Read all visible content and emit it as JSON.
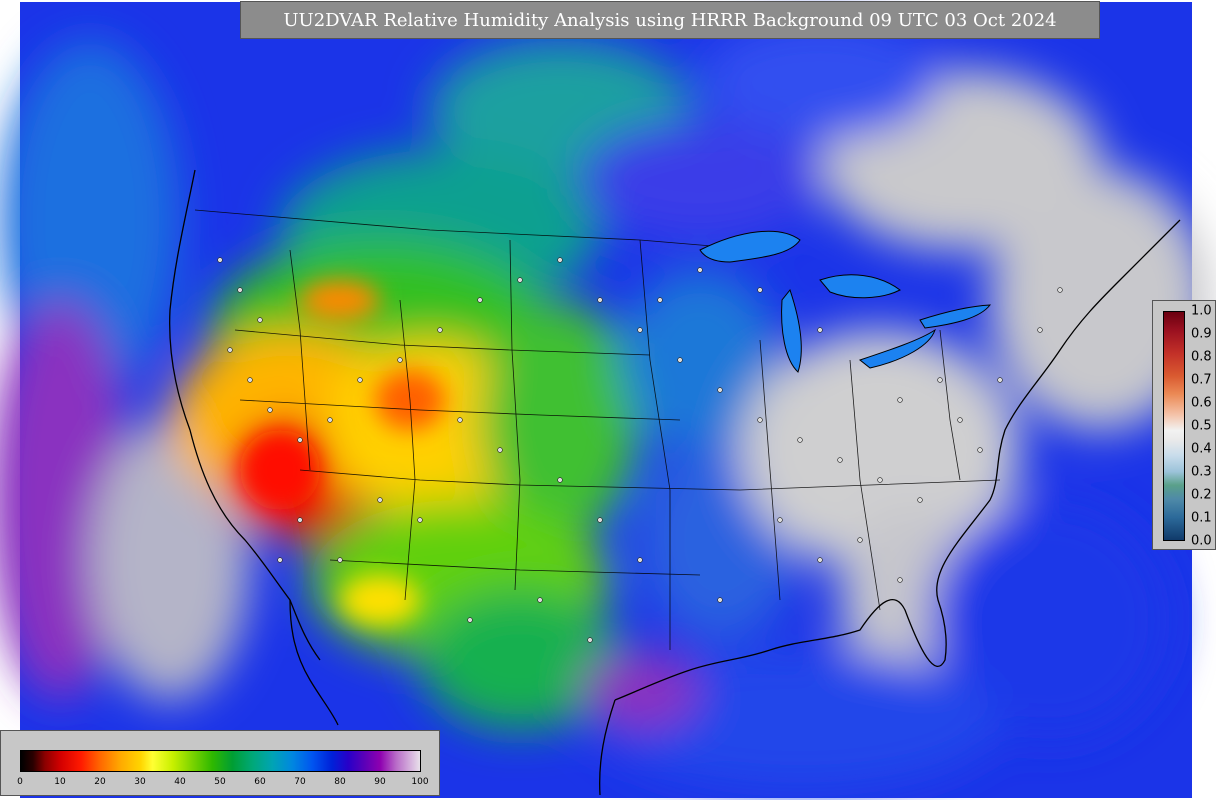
{
  "title": "UU2DVAR Relative Humidity Analysis using HRRR Background 09 UTC 03 Oct 2024",
  "rh_colorbar": {
    "ticks": [
      "0",
      "10",
      "20",
      "30",
      "40",
      "50",
      "60",
      "70",
      "80",
      "90",
      "100"
    ]
  },
  "deviation_colorbar": {
    "ticks": [
      "1.0",
      "0.9",
      "0.8",
      "0.7",
      "0.6",
      "0.5",
      "0.4",
      "0.3",
      "0.2",
      "0.1",
      "0.0"
    ]
  },
  "colors": {
    "ocean_purple": "#6a1fb0",
    "land_gray": "#c9c9c9",
    "panel_gray": "#c7c7c7",
    "title_bg": "#8c8c8c",
    "dry_red": "#e00000",
    "moist_blue": "#1e3cf0",
    "mid_green": "#00a035"
  }
}
